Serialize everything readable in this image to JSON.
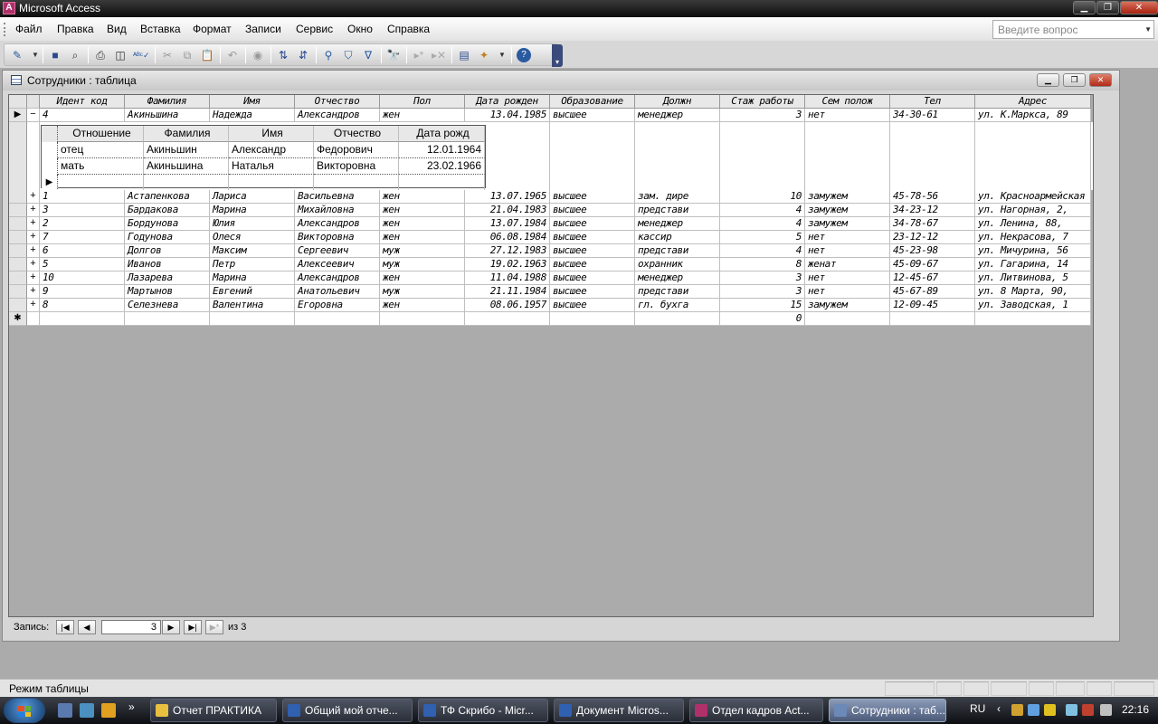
{
  "app": {
    "title": "Microsoft Access",
    "icon": "access-icon"
  },
  "menu": [
    "Файл",
    "Правка",
    "Вид",
    "Вставка",
    "Формат",
    "Записи",
    "Сервис",
    "Окно",
    "Справка"
  ],
  "help_box": {
    "placeholder": "Введите вопрос"
  },
  "toolbar": {
    "buttons": [
      "view-icon",
      "save-icon",
      "search-file-icon",
      "print-icon",
      "print-preview-icon",
      "spelling-icon",
      "cut-icon",
      "copy-icon",
      "paste-icon",
      "undo-icon",
      "hyperlink-icon",
      "sort-ascending-icon",
      "sort-descending-icon",
      "filter-by-selection-icon",
      "filter-by-form-icon",
      "apply-filter-icon",
      "find-icon",
      "new-record-icon",
      "delete-record-icon",
      "database-window-icon",
      "new-object-icon",
      "help-icon"
    ]
  },
  "child_window": {
    "title": "Сотрудники : таблица"
  },
  "table": {
    "columns": [
      "Идент код",
      "Фамилия",
      "Имя",
      "Отчество",
      "Пол",
      "Дата рожден",
      "Образование",
      "Должн",
      "Стаж работы",
      "Сем полож",
      "Тел",
      "Адрес"
    ],
    "expanded_row": [
      "4",
      "Акиньшина",
      "Надежда",
      "Александров",
      "жен",
      "13.04.1985",
      "высшее",
      "менеджер",
      "3",
      "нет",
      "34-30-61",
      "ул. К.Маркса, 89"
    ],
    "rows": [
      [
        "1",
        "Астапенкова",
        "Лариса",
        "Васильевна",
        "жен",
        "13.07.1965",
        "высшее",
        "зам. дире",
        "10",
        "замужем",
        "45-78-56",
        "ул. Красноармейская"
      ],
      [
        "3",
        "Бардакова",
        "Марина",
        "Михайловна",
        "жен",
        "21.04.1983",
        "высшее",
        "представи",
        "4",
        "замужем",
        "34-23-12",
        "ул. Нагорная, 2,"
      ],
      [
        "2",
        "Бордунова",
        "Юлия",
        "Александров",
        "жен",
        "13.07.1984",
        "высшее",
        "менеджер",
        "4",
        "замужем",
        "34-78-67",
        "ул. Ленина, 88,"
      ],
      [
        "7",
        "Годунова",
        "Олеся",
        "Викторовна",
        "жен",
        "06.08.1984",
        "высшее",
        "кассир",
        "5",
        "нет",
        "23-12-12",
        "ул. Некрасова, 7"
      ],
      [
        "6",
        "Долгов",
        "Максим",
        "Сергеевич",
        "муж",
        "27.12.1983",
        "высшее",
        "представи",
        "4",
        "нет",
        "45-23-98",
        "ул. Мичурина, 56"
      ],
      [
        "5",
        "Иванов",
        "Петр",
        "Алексеевич",
        "муж",
        "19.02.1963",
        "высшее",
        "охранник",
        "8",
        "женат",
        "45-09-67",
        "ул. Гагарина, 14"
      ],
      [
        "10",
        "Лазарева",
        "Марина",
        "Александров",
        "жен",
        "11.04.1988",
        "высшее",
        "менеджер",
        "3",
        "нет",
        "12-45-67",
        "ул. Литвинова, 5"
      ],
      [
        "9",
        "Мартынов",
        "Евгений",
        "Анатольевич",
        "муж",
        "21.11.1984",
        "высшее",
        "представи",
        "3",
        "нет",
        "45-67-89",
        "ул. 8 Марта, 90,"
      ],
      [
        "8",
        "Селезнева",
        "Валентина",
        "Егоровна",
        "жен",
        "08.06.1957",
        "высшее",
        "гл. бухга",
        "15",
        "замужем",
        "12-09-45",
        "ул. Заводская, 1"
      ]
    ],
    "new_row_stazh": "0"
  },
  "subtable": {
    "columns": [
      "Отношение",
      "Фамилия",
      "Имя",
      "Отчество",
      "Дата рожд"
    ],
    "rows": [
      [
        "отец",
        "Акиньшин",
        "Александр",
        "Федорович",
        "12.01.1964"
      ],
      [
        "мать",
        "Акиньшина",
        "Наталья",
        "Викторовна",
        "23.02.1966"
      ]
    ]
  },
  "navigation": {
    "label": "Запись:",
    "current": "3",
    "of_text": "из 3"
  },
  "status": {
    "text": "Режим таблицы"
  },
  "taskbar": {
    "tasks": [
      {
        "label": "Отчет ПРАКТИКА",
        "icon": "folder-icon",
        "color": "#e8c040"
      },
      {
        "label": "Общий мой отче...",
        "icon": "word-icon",
        "color": "#3060b0"
      },
      {
        "label": "ТФ Скрибо - Micr...",
        "icon": "word-icon",
        "color": "#3060b0"
      },
      {
        "label": "Документ Micros...",
        "icon": "word-icon",
        "color": "#3060b0"
      },
      {
        "label": "Отдел кадров Act...",
        "icon": "access-icon",
        "color": "#b0306a"
      },
      {
        "label": "Сотрудники : таб...",
        "icon": "table-icon",
        "color": "#6b8ab8"
      }
    ],
    "lang": "RU",
    "time": "22:16"
  }
}
